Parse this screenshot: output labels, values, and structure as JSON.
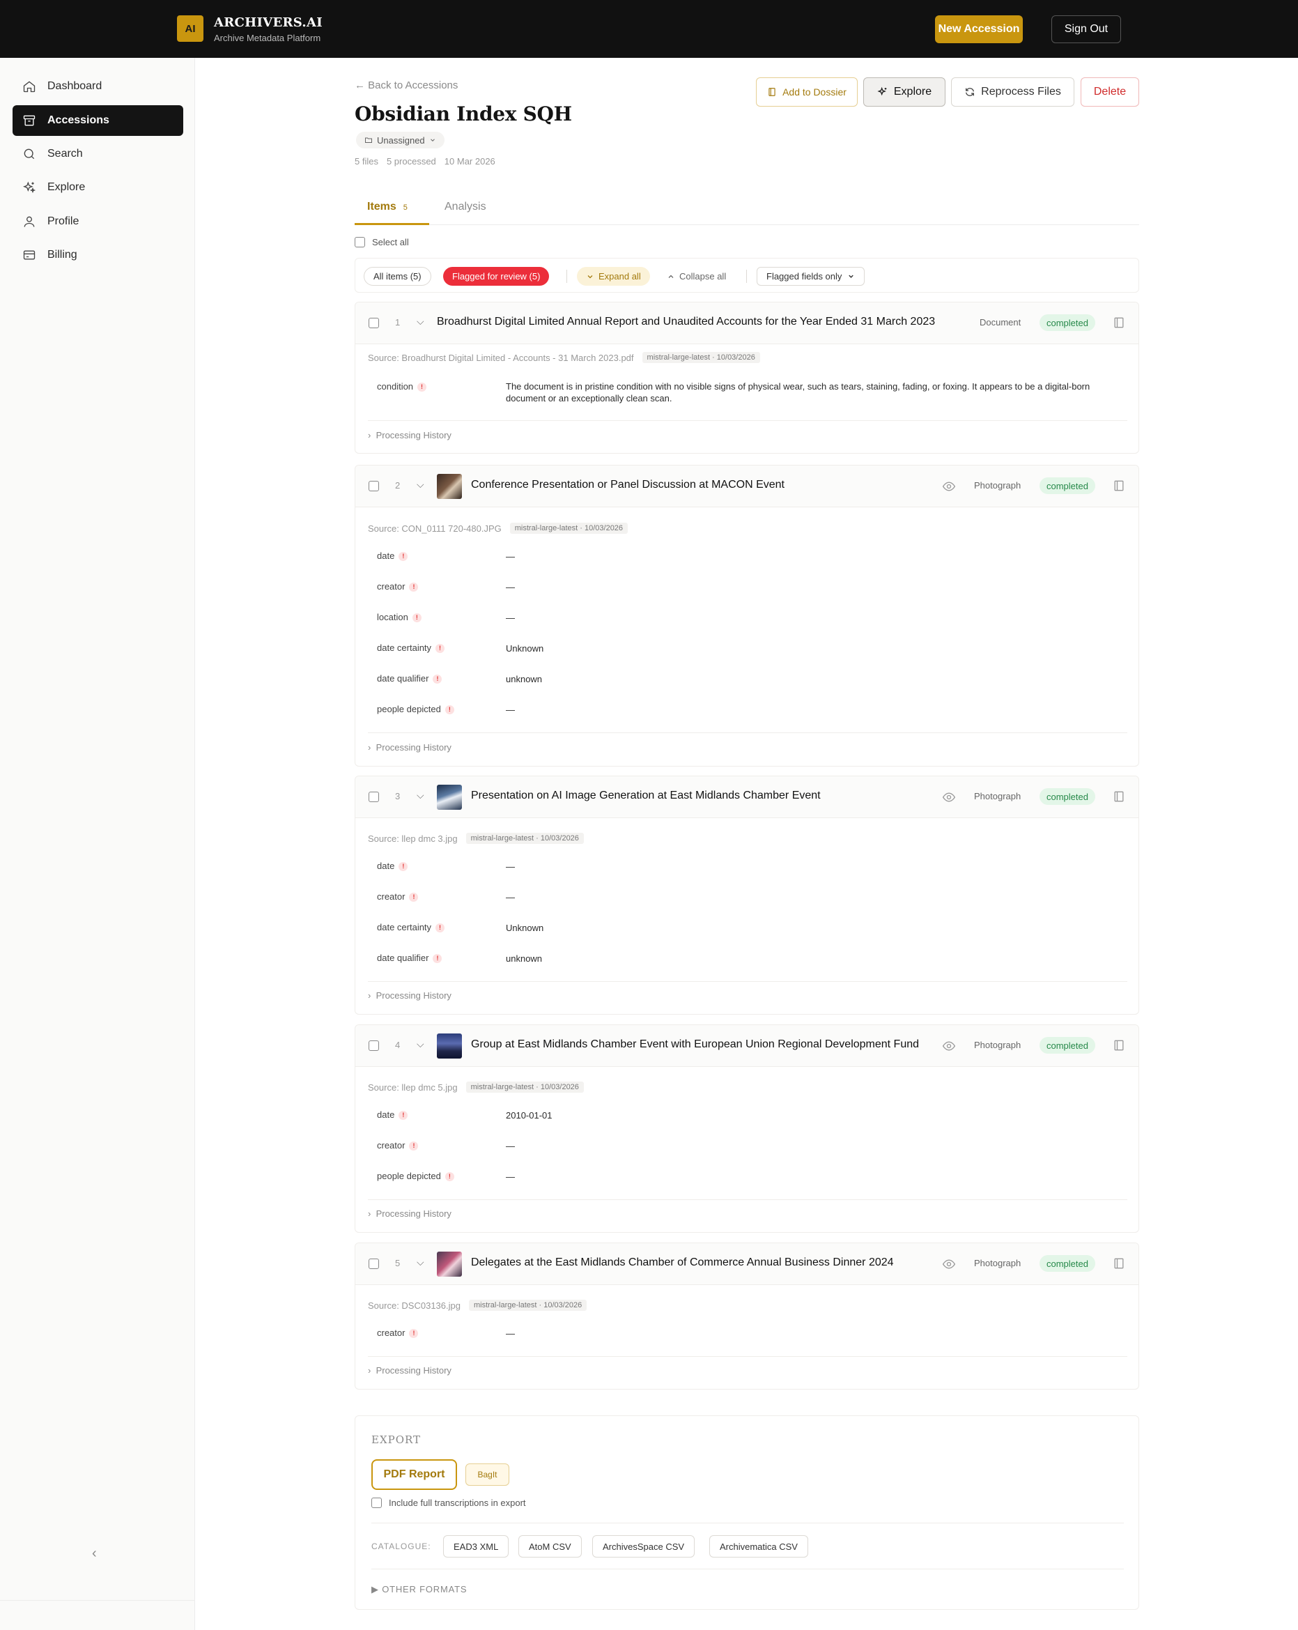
{
  "header": {
    "logo_text": "AI",
    "brand_name": "ARCHIVERS.AI",
    "brand_sub": "Archive Metadata Platform",
    "new_accession": "New Accession",
    "sign_out": "Sign Out"
  },
  "sidebar": {
    "items": [
      {
        "label": "Dashboard",
        "icon": "home-icon"
      },
      {
        "label": "Accessions",
        "icon": "archive-icon",
        "active": true
      },
      {
        "label": "Search",
        "icon": "search-icon"
      },
      {
        "label": "Explore",
        "icon": "sparkle-icon"
      },
      {
        "label": "Profile",
        "icon": "user-icon"
      },
      {
        "label": "Billing",
        "icon": "credit-card-icon"
      }
    ],
    "collapse_glyph": "‹"
  },
  "page": {
    "back": "← Back to Accessions",
    "title": "Obsidian Index SQH",
    "assignment": "Unassigned",
    "meta": [
      "5 files",
      "5 processed",
      "10 Mar 2026"
    ],
    "actions": {
      "add_dossier": "Add to Dossier",
      "explore": "Explore",
      "reprocess": "Reprocess Files",
      "delete": "Delete"
    }
  },
  "tabs": {
    "items_label": "Items",
    "items_count": "5",
    "analysis_label": "Analysis"
  },
  "filters": {
    "select_all": "Select all",
    "all_items": "All items (5)",
    "flagged": "Flagged for review (5)",
    "expand": "Expand all",
    "collapse": "Collapse all",
    "field_filter": "Flagged fields only"
  },
  "items": [
    {
      "num": "1",
      "title": "Broadhurst Digital Limited Annual Report and Unaudited Accounts for the Year Ended 31 March 2023",
      "type": "Document",
      "status": "completed",
      "source": "Source: Broadhurst Digital Limited - Accounts - 31 March 2023.pdf",
      "model": "mistral-large-latest · 10/03/2026",
      "fields": [
        {
          "name": "condition",
          "value": "The document is in pristine condition with no visible signs of physical wear, such as tears, staining, fading, or foxing. It appears to be a digital-born document or an exceptionally clean scan."
        }
      ],
      "history": "Processing History"
    },
    {
      "num": "2",
      "title": "Conference Presentation or Panel Discussion at MACON Event",
      "type": "Photograph",
      "status": "completed",
      "source": "Source: CON_0111 720-480.JPG",
      "model": "mistral-large-latest · 10/03/2026",
      "fields": [
        {
          "name": "date",
          "value": "—"
        },
        {
          "name": "creator",
          "value": "—"
        },
        {
          "name": "location",
          "value": "—"
        },
        {
          "name": "date certainty",
          "value": "Unknown"
        },
        {
          "name": "date qualifier",
          "value": "unknown"
        },
        {
          "name": "people depicted",
          "value": "—"
        }
      ],
      "history": "Processing History"
    },
    {
      "num": "3",
      "title": "Presentation on AI Image Generation at East Midlands Chamber Event",
      "type": "Photograph",
      "status": "completed",
      "source": "Source: llep dmc 3.jpg",
      "model": "mistral-large-latest · 10/03/2026",
      "fields": [
        {
          "name": "date",
          "value": "—"
        },
        {
          "name": "creator",
          "value": "—"
        },
        {
          "name": "date certainty",
          "value": "Unknown"
        },
        {
          "name": "date qualifier",
          "value": "unknown"
        }
      ],
      "history": "Processing History"
    },
    {
      "num": "4",
      "title": "Group at East Midlands Chamber Event with European Union Regional Development Fund",
      "type": "Photograph",
      "status": "completed",
      "source": "Source: llep dmc 5.jpg",
      "model": "mistral-large-latest · 10/03/2026",
      "fields": [
        {
          "name": "date",
          "value": "2010-01-01"
        },
        {
          "name": "creator",
          "value": "—"
        },
        {
          "name": "people depicted",
          "value": "—"
        }
      ],
      "history": "Processing History"
    },
    {
      "num": "5",
      "title": "Delegates at the East Midlands Chamber of Commerce Annual Business Dinner 2024",
      "type": "Photograph",
      "status": "completed",
      "source": "Source: DSC03136.jpg",
      "model": "mistral-large-latest · 10/03/2026",
      "fields": [
        {
          "name": "creator",
          "value": "—"
        }
      ],
      "history": "Processing History"
    }
  ],
  "export": {
    "title": "EXPORT",
    "pdf": "PDF Report",
    "bagit": "BagIt",
    "include": "Include full transcriptions in export",
    "catalogue_label": "CATALOGUE:",
    "catalogue": [
      "EAD3 XML",
      "AtoM CSV",
      "ArchivesSpace CSV",
      "Archivematica CSV"
    ],
    "other": "▶ OTHER FORMATS"
  },
  "colors": {
    "accent": "#c9960f",
    "flag": "#ec2e3a",
    "status_green": "#27894a"
  }
}
